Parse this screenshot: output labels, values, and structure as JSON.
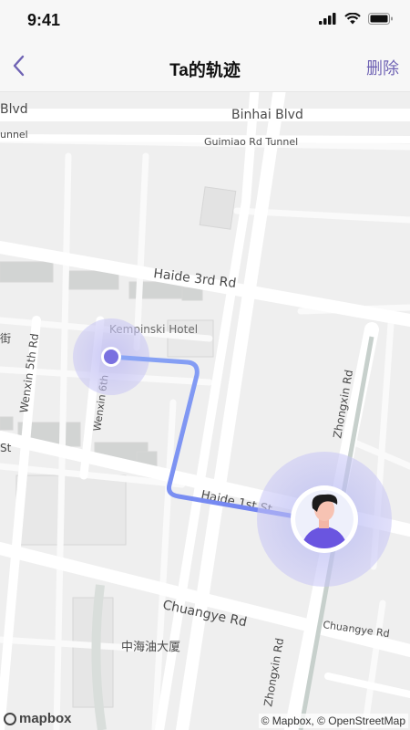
{
  "status_bar": {
    "time": "9:41"
  },
  "nav": {
    "title": "Ta的轨迹",
    "delete_label": "删除"
  },
  "map": {
    "labels": {
      "binhai_left": "Blvd",
      "binhai": "Binhai Blvd",
      "tunnel_left": "unnel",
      "guimiao": "Guimiao Rd Tunnel",
      "haide3": "Haide 3rd Rd",
      "kempinski": "Kempinski Hotel",
      "wenxin5": "Wenxin 5th Rd",
      "wenxin6": "Wenxin 6th",
      "street_cn": "街",
      "st_left": "St",
      "haide1": "Haide 1st St",
      "zhongxin_top": "Zhongxin Rd",
      "chuangye": "Chuangye Rd",
      "chuangye_right": "Chuangye Rd",
      "zhonghaiyou": "中海油大厦",
      "zhongxin_bottom": "Zhongxin Rd"
    },
    "attribution": "© Mapbox, © OpenStreetMap",
    "logo_text": "mapbox",
    "route_color": "#6e8df2",
    "accent_color": "#6a5fd8"
  }
}
